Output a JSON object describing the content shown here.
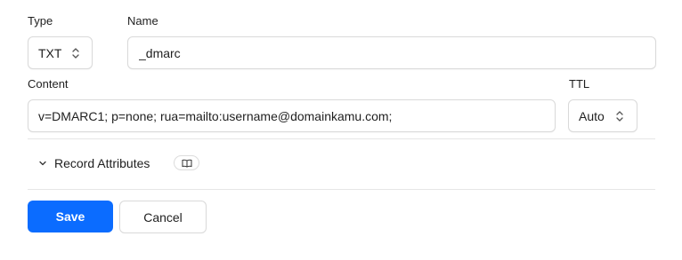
{
  "form": {
    "type": {
      "label": "Type",
      "value": "TXT"
    },
    "name": {
      "label": "Name",
      "value": "_dmarc"
    },
    "content": {
      "label": "Content",
      "value": "v=DMARC1; p=none; rua=mailto:username@domainkamu.com;"
    },
    "ttl": {
      "label": "TTL",
      "value": "Auto"
    },
    "record_attributes": {
      "label": "Record Attributes",
      "icon": "book-icon",
      "expander_icon": "chevron-down-icon"
    }
  },
  "actions": {
    "save_label": "Save",
    "cancel_label": "Cancel"
  },
  "colors": {
    "primary": "#0b6cff",
    "border": "#d9d9d9",
    "divider": "#e6e6e6",
    "text": "#1f1f1f"
  }
}
